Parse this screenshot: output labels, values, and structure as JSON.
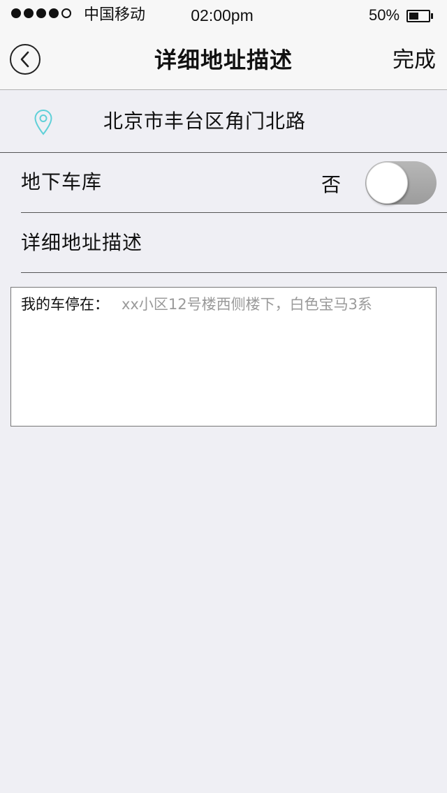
{
  "status_bar": {
    "carrier": "中国移动",
    "time": "02:00pm",
    "battery_percent": "50%",
    "battery_level": 0.5,
    "signal_bars_filled": 4,
    "signal_bars_total": 5
  },
  "nav": {
    "title": "详细地址描述",
    "done_label": "完成",
    "back_icon": "chevron-left-icon"
  },
  "location": {
    "icon": "map-pin-icon",
    "icon_color": "#5fd0d8",
    "address": "北京市丰台区角门北路"
  },
  "garage": {
    "label": "地下车库",
    "value": "否",
    "enabled": false
  },
  "description": {
    "label": "详细地址描述",
    "prefix": "我的车停在：",
    "placeholder": "xx小区12号楼西侧楼下，白色宝马3系"
  }
}
